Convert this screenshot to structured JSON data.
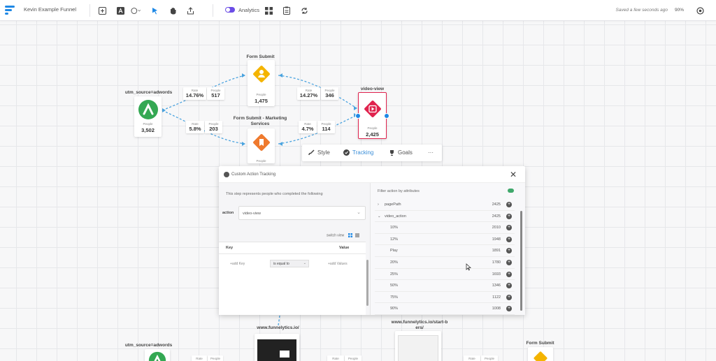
{
  "toolbar": {
    "funnel_name": "Kevin Example Funnel",
    "analytics_label": "Analytics",
    "saved_status": "Saved a few seconds ago",
    "zoom": "90%",
    "accent_color": "#6b4de6"
  },
  "canvas": {
    "nodes": [
      {
        "label": "utm_source=adwords",
        "people_label": "People",
        "people": "3,502",
        "icon": "adwords-icon",
        "color": "#34a853"
      },
      {
        "label": "Form Submit",
        "people_label": "People",
        "people": "1,475",
        "icon": "person-form-icon",
        "color": "#f4b400"
      },
      {
        "label": "Form Submit - Marketing Services",
        "people_label": "People",
        "icon": "form-icon",
        "color": "#ef7a2e"
      },
      {
        "label": "video-view",
        "people_label": "People",
        "people": "2,425",
        "icon": "video-play-icon",
        "color": "#e0234e"
      }
    ],
    "stats": [
      {
        "rate_label": "Rate",
        "rate": "14.76%",
        "people_label": "People",
        "people": "517"
      },
      {
        "rate_label": "Rate",
        "rate": "5.8%",
        "people_label": "People",
        "people": "203"
      },
      {
        "rate_label": "Rate",
        "rate": "14.27%",
        "people_label": "People",
        "people": "346"
      },
      {
        "rate_label": "Rate",
        "rate": "4.7%",
        "people_label": "People",
        "people": "114"
      }
    ],
    "bottom_nodes": [
      {
        "label": "utm_source=adwords"
      },
      {
        "label": "www.funnelytics.io/"
      },
      {
        "label": "www.funnelytics.io/start-b",
        "label2": "ers/"
      },
      {
        "label": "Form Submit"
      }
    ],
    "bottom_stats": [
      "Rate",
      "People",
      "Rate",
      "People",
      "Rate",
      "People"
    ]
  },
  "step_tabs": {
    "style": "Style",
    "tracking": "Tracking",
    "goals": "Goals",
    "more": "···"
  },
  "modal": {
    "title": "Custom Action Tracking",
    "description": "This step represents people who completed the following",
    "action_label": "action",
    "action_value": "video-view",
    "switch_view": "switch view",
    "key_header": "Key",
    "value_header": "Value",
    "add_key": "+add Key",
    "operator": "is equal to",
    "add_values": "+add Values",
    "filter_label": "Filter action by attributes",
    "attributes": [
      {
        "name": "pagePath",
        "count": "2425",
        "expander": "›"
      },
      {
        "name": "video_action",
        "count": "2425",
        "expander": "⌄"
      },
      {
        "name": "10%",
        "count": "2010"
      },
      {
        "name": "12%",
        "count": "1948"
      },
      {
        "name": "Play",
        "count": "1891"
      },
      {
        "name": "20%",
        "count": "1780"
      },
      {
        "name": "25%",
        "count": "1693"
      },
      {
        "name": "50%",
        "count": "1346"
      },
      {
        "name": "75%",
        "count": "1122"
      },
      {
        "name": "90%",
        "count": "1008"
      }
    ]
  }
}
